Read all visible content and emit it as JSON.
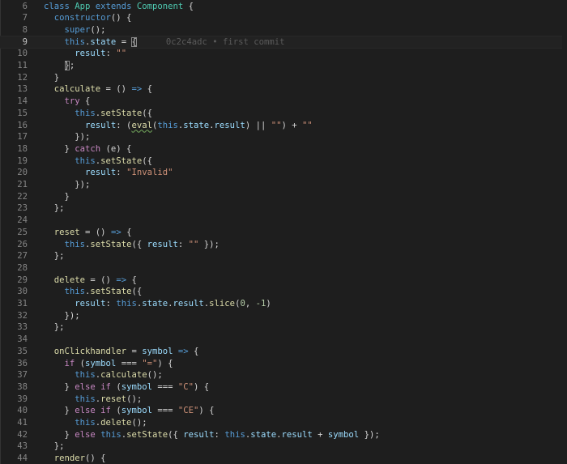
{
  "editor": {
    "blame_text": "0c2c4adc • first commit",
    "lines": [
      {
        "num": "6",
        "tokens": [
          {
            "t": "class ",
            "c": "keyword"
          },
          {
            "t": "App ",
            "c": "class"
          },
          {
            "t": "extends ",
            "c": "keyword"
          },
          {
            "t": "Component ",
            "c": "class"
          },
          {
            "t": "{",
            "c": "plain"
          }
        ]
      },
      {
        "num": "7",
        "tokens": [
          {
            "t": "  constructor",
            "c": "keyword"
          },
          {
            "t": "() {",
            "c": "plain"
          }
        ]
      },
      {
        "num": "8",
        "tokens": [
          {
            "t": "    super",
            "c": "keyword"
          },
          {
            "t": "();",
            "c": "plain"
          }
        ]
      },
      {
        "num": "9",
        "current": true,
        "blame": true,
        "tokens": [
          {
            "t": "    this",
            "c": "keyword"
          },
          {
            "t": ".",
            "c": "plain"
          },
          {
            "t": "state",
            "c": "prop"
          },
          {
            "t": " = ",
            "c": "plain"
          },
          {
            "t": "{",
            "c": "plain",
            "bracket": true
          }
        ]
      },
      {
        "num": "10",
        "tokens": [
          {
            "t": "      result",
            "c": "prop"
          },
          {
            "t": ": ",
            "c": "plain"
          },
          {
            "t": "\"\"",
            "c": "string"
          }
        ]
      },
      {
        "num": "11",
        "tokens": [
          {
            "t": "    ",
            "c": "plain"
          },
          {
            "t": "}",
            "c": "plain",
            "bracket": true
          },
          {
            "t": ";",
            "c": "plain"
          }
        ]
      },
      {
        "num": "12",
        "tokens": [
          {
            "t": "  }",
            "c": "plain"
          }
        ]
      },
      {
        "num": "13",
        "tokens": [
          {
            "t": "  calculate",
            "c": "func"
          },
          {
            "t": " = () ",
            "c": "plain"
          },
          {
            "t": "=>",
            "c": "keyword"
          },
          {
            "t": " {",
            "c": "plain"
          }
        ]
      },
      {
        "num": "14",
        "tokens": [
          {
            "t": "    try",
            "c": "control"
          },
          {
            "t": " {",
            "c": "plain"
          }
        ]
      },
      {
        "num": "15",
        "tokens": [
          {
            "t": "      this",
            "c": "keyword"
          },
          {
            "t": ".",
            "c": "plain"
          },
          {
            "t": "setState",
            "c": "func"
          },
          {
            "t": "({",
            "c": "plain"
          }
        ]
      },
      {
        "num": "16",
        "tokens": [
          {
            "t": "        result",
            "c": "prop"
          },
          {
            "t": ": (",
            "c": "plain"
          },
          {
            "t": "eval",
            "c": "func",
            "warn": true
          },
          {
            "t": "(",
            "c": "plain"
          },
          {
            "t": "this",
            "c": "keyword"
          },
          {
            "t": ".",
            "c": "plain"
          },
          {
            "t": "state",
            "c": "prop"
          },
          {
            "t": ".",
            "c": "plain"
          },
          {
            "t": "result",
            "c": "prop"
          },
          {
            "t": ") || ",
            "c": "plain"
          },
          {
            "t": "\"\"",
            "c": "string"
          },
          {
            "t": ") + ",
            "c": "plain"
          },
          {
            "t": "\"\"",
            "c": "string"
          }
        ]
      },
      {
        "num": "17",
        "tokens": [
          {
            "t": "      });",
            "c": "plain"
          }
        ]
      },
      {
        "num": "18",
        "tokens": [
          {
            "t": "    } ",
            "c": "plain"
          },
          {
            "t": "catch",
            "c": "control"
          },
          {
            "t": " (e) {",
            "c": "plain"
          }
        ]
      },
      {
        "num": "19",
        "tokens": [
          {
            "t": "      this",
            "c": "keyword"
          },
          {
            "t": ".",
            "c": "plain"
          },
          {
            "t": "setState",
            "c": "func"
          },
          {
            "t": "({",
            "c": "plain"
          }
        ]
      },
      {
        "num": "20",
        "tokens": [
          {
            "t": "        result",
            "c": "prop"
          },
          {
            "t": ": ",
            "c": "plain"
          },
          {
            "t": "\"Invalid\"",
            "c": "string"
          }
        ]
      },
      {
        "num": "21",
        "tokens": [
          {
            "t": "      });",
            "c": "plain"
          }
        ]
      },
      {
        "num": "22",
        "tokens": [
          {
            "t": "    }",
            "c": "plain"
          }
        ]
      },
      {
        "num": "23",
        "tokens": [
          {
            "t": "  };",
            "c": "plain"
          }
        ]
      },
      {
        "num": "24",
        "tokens": []
      },
      {
        "num": "25",
        "tokens": [
          {
            "t": "  reset",
            "c": "func"
          },
          {
            "t": " = () ",
            "c": "plain"
          },
          {
            "t": "=>",
            "c": "keyword"
          },
          {
            "t": " {",
            "c": "plain"
          }
        ]
      },
      {
        "num": "26",
        "tokens": [
          {
            "t": "    this",
            "c": "keyword"
          },
          {
            "t": ".",
            "c": "plain"
          },
          {
            "t": "setState",
            "c": "func"
          },
          {
            "t": "({ ",
            "c": "plain"
          },
          {
            "t": "result",
            "c": "prop"
          },
          {
            "t": ": ",
            "c": "plain"
          },
          {
            "t": "\"\"",
            "c": "string"
          },
          {
            "t": " });",
            "c": "plain"
          }
        ]
      },
      {
        "num": "27",
        "tokens": [
          {
            "t": "  };",
            "c": "plain"
          }
        ]
      },
      {
        "num": "28",
        "tokens": []
      },
      {
        "num": "29",
        "tokens": [
          {
            "t": "  delete",
            "c": "func"
          },
          {
            "t": " = () ",
            "c": "plain"
          },
          {
            "t": "=>",
            "c": "keyword"
          },
          {
            "t": " {",
            "c": "plain"
          }
        ]
      },
      {
        "num": "30",
        "tokens": [
          {
            "t": "    this",
            "c": "keyword"
          },
          {
            "t": ".",
            "c": "plain"
          },
          {
            "t": "setState",
            "c": "func"
          },
          {
            "t": "({",
            "c": "plain"
          }
        ]
      },
      {
        "num": "31",
        "tokens": [
          {
            "t": "      result",
            "c": "prop"
          },
          {
            "t": ": ",
            "c": "plain"
          },
          {
            "t": "this",
            "c": "keyword"
          },
          {
            "t": ".",
            "c": "plain"
          },
          {
            "t": "state",
            "c": "prop"
          },
          {
            "t": ".",
            "c": "plain"
          },
          {
            "t": "result",
            "c": "prop"
          },
          {
            "t": ".",
            "c": "plain"
          },
          {
            "t": "slice",
            "c": "func"
          },
          {
            "t": "(",
            "c": "plain"
          },
          {
            "t": "0",
            "c": "number"
          },
          {
            "t": ", ",
            "c": "plain"
          },
          {
            "t": "-1",
            "c": "number"
          },
          {
            "t": ")",
            "c": "plain"
          }
        ]
      },
      {
        "num": "32",
        "tokens": [
          {
            "t": "    });",
            "c": "plain"
          }
        ]
      },
      {
        "num": "33",
        "tokens": [
          {
            "t": "  };",
            "c": "plain"
          }
        ]
      },
      {
        "num": "34",
        "tokens": []
      },
      {
        "num": "35",
        "tokens": [
          {
            "t": "  onClickhandler",
            "c": "func"
          },
          {
            "t": " = ",
            "c": "plain"
          },
          {
            "t": "symbol",
            "c": "prop"
          },
          {
            "t": " ",
            "c": "plain"
          },
          {
            "t": "=>",
            "c": "keyword"
          },
          {
            "t": " {",
            "c": "plain"
          }
        ]
      },
      {
        "num": "36",
        "tokens": [
          {
            "t": "    if",
            "c": "control"
          },
          {
            "t": " (",
            "c": "plain"
          },
          {
            "t": "symbol",
            "c": "prop"
          },
          {
            "t": " === ",
            "c": "plain"
          },
          {
            "t": "\"=\"",
            "c": "string"
          },
          {
            "t": ") {",
            "c": "plain"
          }
        ]
      },
      {
        "num": "37",
        "tokens": [
          {
            "t": "      this",
            "c": "keyword"
          },
          {
            "t": ".",
            "c": "plain"
          },
          {
            "t": "calculate",
            "c": "func"
          },
          {
            "t": "();",
            "c": "plain"
          }
        ]
      },
      {
        "num": "38",
        "tokens": [
          {
            "t": "    } ",
            "c": "plain"
          },
          {
            "t": "else if",
            "c": "control"
          },
          {
            "t": " (",
            "c": "plain"
          },
          {
            "t": "symbol",
            "c": "prop"
          },
          {
            "t": " === ",
            "c": "plain"
          },
          {
            "t": "\"C\"",
            "c": "string"
          },
          {
            "t": ") {",
            "c": "plain"
          }
        ]
      },
      {
        "num": "39",
        "tokens": [
          {
            "t": "      this",
            "c": "keyword"
          },
          {
            "t": ".",
            "c": "plain"
          },
          {
            "t": "reset",
            "c": "func"
          },
          {
            "t": "();",
            "c": "plain"
          }
        ]
      },
      {
        "num": "40",
        "tokens": [
          {
            "t": "    } ",
            "c": "plain"
          },
          {
            "t": "else if",
            "c": "control"
          },
          {
            "t": " (",
            "c": "plain"
          },
          {
            "t": "symbol",
            "c": "prop"
          },
          {
            "t": " === ",
            "c": "plain"
          },
          {
            "t": "\"CE\"",
            "c": "string"
          },
          {
            "t": ") {",
            "c": "plain"
          }
        ]
      },
      {
        "num": "41",
        "tokens": [
          {
            "t": "      this",
            "c": "keyword"
          },
          {
            "t": ".",
            "c": "plain"
          },
          {
            "t": "delete",
            "c": "func"
          },
          {
            "t": "();",
            "c": "plain"
          }
        ]
      },
      {
        "num": "42",
        "tokens": [
          {
            "t": "    } ",
            "c": "plain"
          },
          {
            "t": "else",
            "c": "control"
          },
          {
            "t": " ",
            "c": "plain"
          },
          {
            "t": "this",
            "c": "keyword"
          },
          {
            "t": ".",
            "c": "plain"
          },
          {
            "t": "setState",
            "c": "func"
          },
          {
            "t": "({ ",
            "c": "plain"
          },
          {
            "t": "result",
            "c": "prop"
          },
          {
            "t": ": ",
            "c": "plain"
          },
          {
            "t": "this",
            "c": "keyword"
          },
          {
            "t": ".",
            "c": "plain"
          },
          {
            "t": "state",
            "c": "prop"
          },
          {
            "t": ".",
            "c": "plain"
          },
          {
            "t": "result",
            "c": "prop"
          },
          {
            "t": " + ",
            "c": "plain"
          },
          {
            "t": "symbol",
            "c": "prop"
          },
          {
            "t": " });",
            "c": "plain"
          }
        ]
      },
      {
        "num": "43",
        "tokens": [
          {
            "t": "  };",
            "c": "plain"
          }
        ]
      },
      {
        "num": "44",
        "tokens": [
          {
            "t": "  render",
            "c": "func"
          },
          {
            "t": "() {",
            "c": "plain"
          }
        ]
      }
    ]
  }
}
